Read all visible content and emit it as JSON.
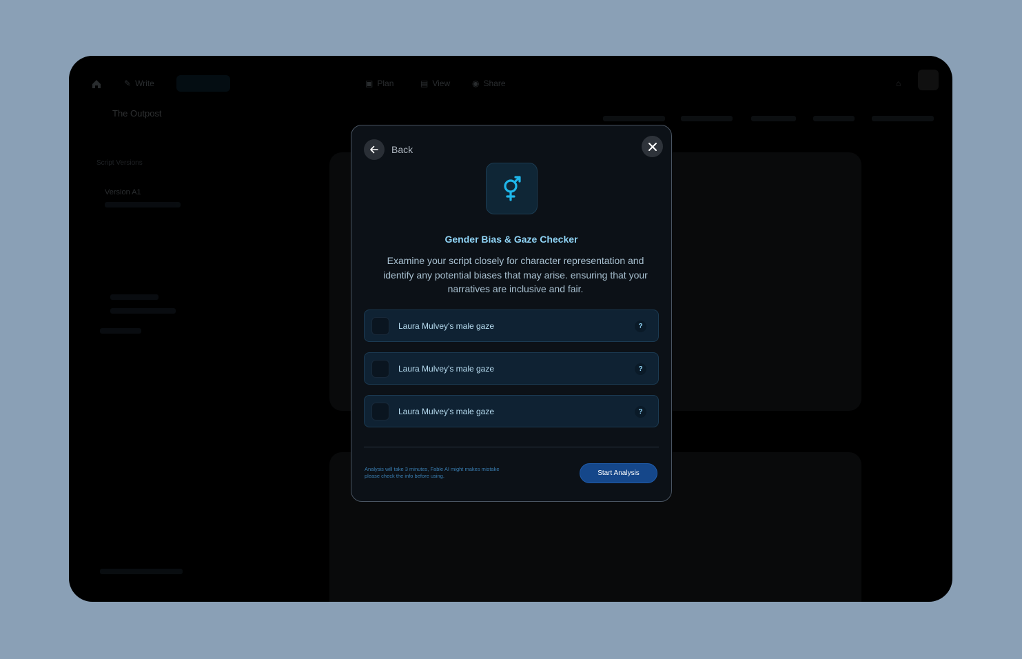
{
  "app": {
    "project_title": "The Outpost",
    "nav": [
      "Write",
      "Plan",
      "View",
      "Share"
    ],
    "sidebar_section": "Script Versions",
    "sidebar_item": "Version A1"
  },
  "modal": {
    "back_label": "Back",
    "title": "Gender Bias & Gaze Checker",
    "description": "Examine your script closely for character representation and identify any potential biases that may arise.  ensuring that your narratives are inclusive and fair.",
    "options": [
      {
        "label": "Laura Mulvey's  male gaze",
        "help": "?"
      },
      {
        "label": "Laura Mulvey's  male gaze",
        "help": "?"
      },
      {
        "label": "Laura Mulvey's  male gaze",
        "help": "?"
      }
    ],
    "footnote": "Analysis will take 3 minutes, Fable AI might makes mistake please check the info before using.",
    "start_label": "Start Analysis"
  },
  "colors": {
    "accent": "#8fd3f5",
    "primary_button": "#15478a",
    "backdrop": "#8aa0b6"
  }
}
